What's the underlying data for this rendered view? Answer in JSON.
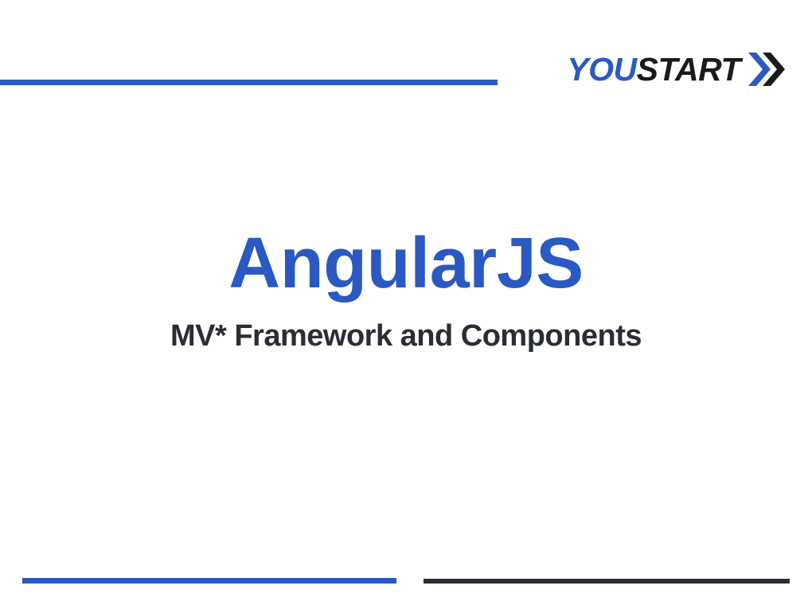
{
  "logo": {
    "you": "YOU",
    "start": "START"
  },
  "content": {
    "title": "AngularJS",
    "subtitle": "MV* Framework and Components"
  },
  "colors": {
    "accent_blue": "#2b59c3",
    "dark": "#2a2d34"
  }
}
